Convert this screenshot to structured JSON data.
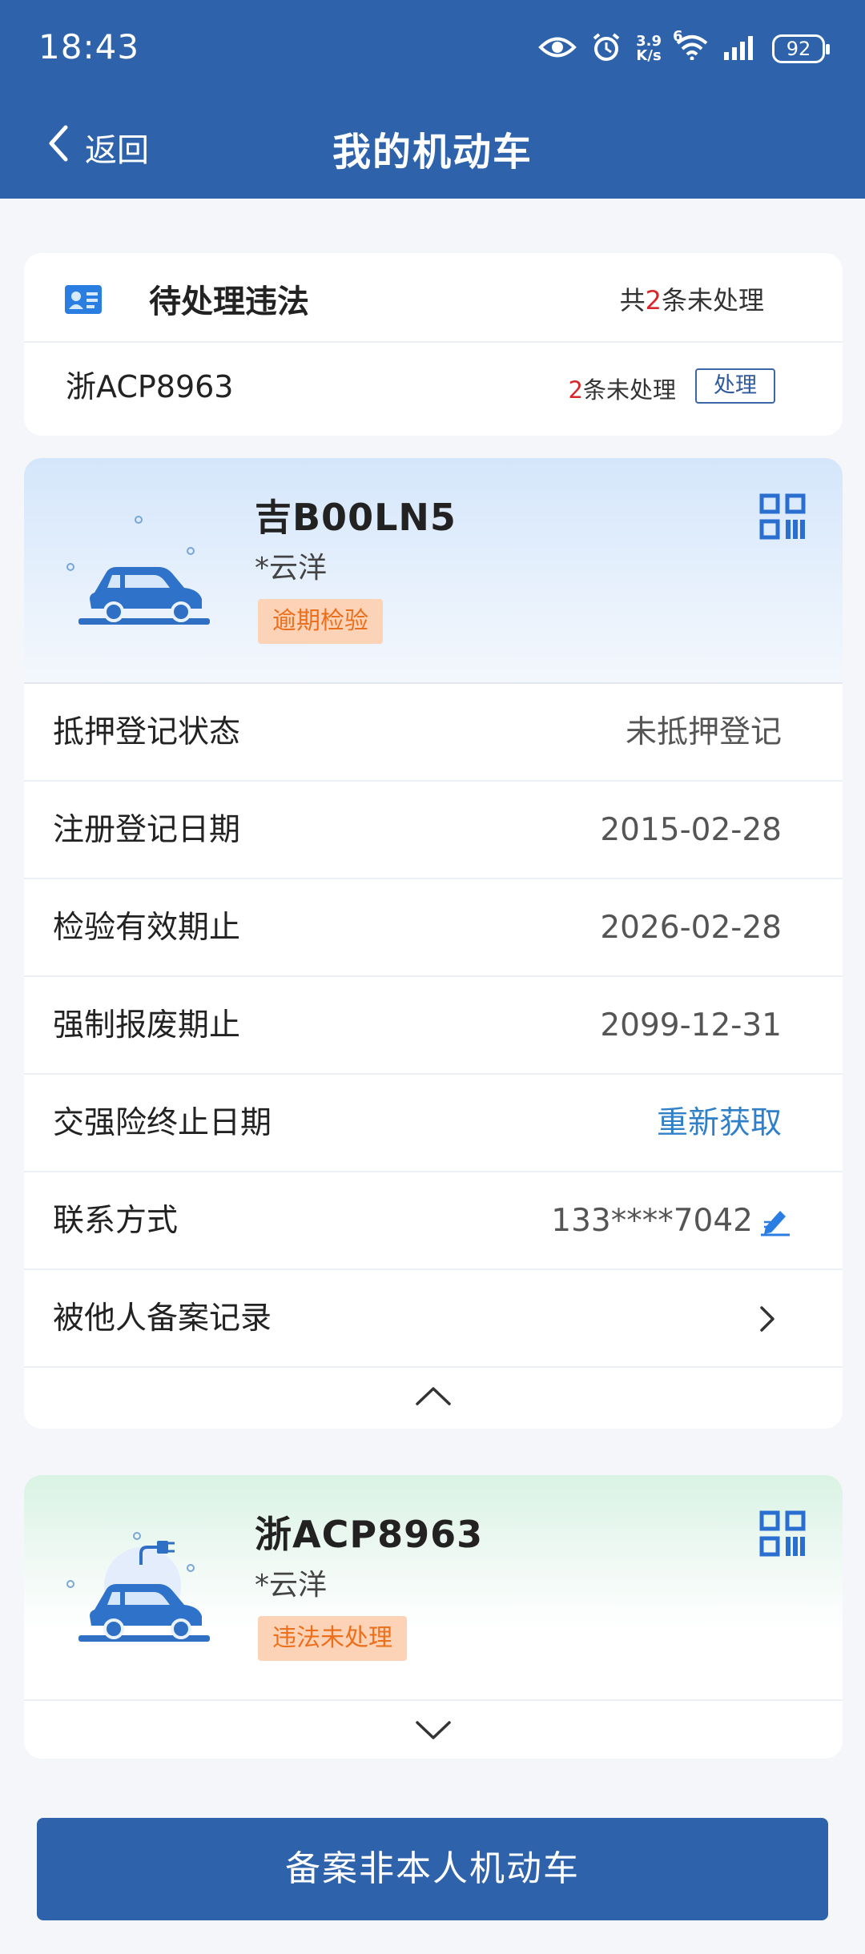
{
  "status_bar": {
    "time": "18:43",
    "speed_value": "3.9",
    "speed_unit": "K/s",
    "network": "6",
    "battery": "92"
  },
  "nav": {
    "back_label": "返回",
    "title": "我的机动车"
  },
  "violations": {
    "title": "待处理违法",
    "total_prefix": "共",
    "total_count": "2",
    "total_suffix": "条未处理",
    "plate": "浙ACP8963",
    "count": "2",
    "count_suffix": "条未处理",
    "action_label": "处理"
  },
  "vehicles": [
    {
      "plate": "吉B00LN5",
      "owner": "*云洋",
      "badge": "逾期检验",
      "theme": "blue",
      "rows": [
        {
          "label": "抵押登记状态",
          "value": "未抵押登记"
        },
        {
          "label": "注册登记日期",
          "value": "2015-02-28"
        },
        {
          "label": "检验有效期止",
          "value": "2026-02-28"
        },
        {
          "label": "强制报废期止",
          "value": "2099-12-31"
        },
        {
          "label": "交强险终止日期",
          "value": "重新获取"
        },
        {
          "label": "联系方式",
          "value": "133****7042"
        },
        {
          "label": "被他人备案记录",
          "value": ""
        }
      ]
    },
    {
      "plate": "浙ACP8963",
      "owner": "*云洋",
      "badge": "违法未处理",
      "theme": "green"
    }
  ],
  "bottom_button": "备案非本人机动车",
  "colors": {
    "primary": "#2e63ab",
    "badge_bg": "#fcd3b6",
    "badge_text": "#ec6f1d",
    "link": "#2f7fc9",
    "alert": "#d6282b"
  },
  "icons": [
    "eye-icon",
    "alarm-icon",
    "wifi-icon",
    "signal-icon",
    "battery-icon",
    "back-chevron-icon",
    "id-card-icon",
    "car-icon",
    "ev-car-icon",
    "qr-code-icon",
    "edit-icon",
    "chevron-right-icon",
    "chevron-up-icon",
    "chevron-down-icon"
  ]
}
